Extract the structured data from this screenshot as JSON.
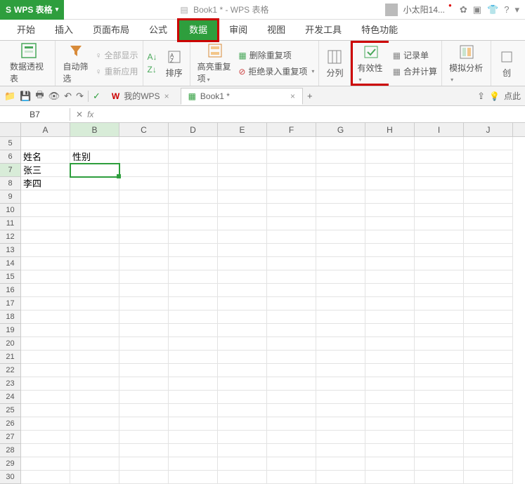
{
  "app": {
    "name": "WPS 表格",
    "doc_title": "Book1 * - WPS 表格"
  },
  "user": {
    "name": "小太阳14..."
  },
  "menu": {
    "tabs": [
      "开始",
      "插入",
      "页面布局",
      "公式",
      "数据",
      "审阅",
      "视图",
      "开发工具",
      "特色功能"
    ],
    "active": "数据"
  },
  "ribbon": {
    "pivot": "数据透视表",
    "autofilter": "自动筛选",
    "showall": "全部显示",
    "reapply": "重新应用",
    "sort": "排序",
    "highlight_dup": "高亮重复项",
    "remove_dup": "删除重复项",
    "reject_dup": "拒绝录入重复项",
    "text_to_col": "分列",
    "validity": "有效性",
    "record_form": "记录单",
    "consolidate": "合并计算",
    "whatif": "模拟分析",
    "create": "创"
  },
  "qa": {
    "mywps": "我的WPS",
    "book": "Book1 *",
    "click_here": "点此"
  },
  "formula_bar": {
    "cell_ref": "B7",
    "fx": "fx",
    "value": ""
  },
  "columns": [
    "A",
    "B",
    "C",
    "D",
    "E",
    "F",
    "G",
    "H",
    "I",
    "J"
  ],
  "row_start": 5,
  "row_end": 30,
  "cells": {
    "A6": "姓名",
    "B6": "性别",
    "A7": "张三",
    "A8": "李四"
  },
  "selected": {
    "row": 7,
    "col": "B"
  }
}
